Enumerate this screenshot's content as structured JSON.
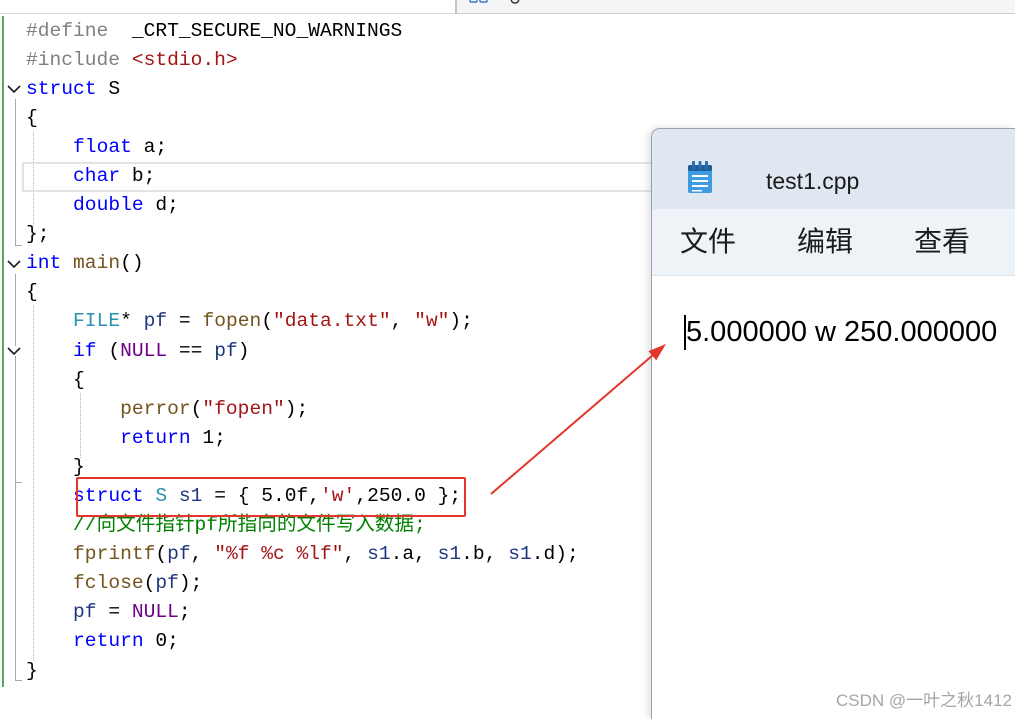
{
  "top_strip": {
    "tab_icon": "file-tab-icon"
  },
  "editor": {
    "syntax_colors": {
      "pp": "#808080",
      "kw": "#0000ff",
      "type": "#2b91af",
      "str": "#a31515",
      "fn": "#74531f",
      "var": "#1f377f",
      "macro": "#6f008a",
      "cmt": "#008000",
      "plain": "#000000"
    },
    "change_bar_color": "#58a85a",
    "fold_icon": "chevron-down-icon",
    "lines": [
      [
        {
          "kind": "pp",
          "text": "#define"
        },
        {
          "kind": "plain",
          "text": "  _CRT_SECURE_NO_WARNINGS"
        }
      ],
      [
        {
          "kind": "pp",
          "text": "#include"
        },
        {
          "kind": "plain",
          "text": " "
        },
        {
          "kind": "str",
          "text": "<stdio.h>"
        }
      ],
      [
        {
          "kind": "kw",
          "text": "struct"
        },
        {
          "kind": "plain",
          "text": " S"
        }
      ],
      [
        {
          "kind": "plain",
          "text": "{"
        }
      ],
      [
        {
          "kind": "plain",
          "text": "    "
        },
        {
          "kind": "kw",
          "text": "float"
        },
        {
          "kind": "plain",
          "text": " a;"
        }
      ],
      [
        {
          "kind": "plain",
          "text": "    "
        },
        {
          "kind": "kw",
          "text": "char"
        },
        {
          "kind": "plain",
          "text": " b;"
        }
      ],
      [
        {
          "kind": "plain",
          "text": "    "
        },
        {
          "kind": "kw",
          "text": "double"
        },
        {
          "kind": "plain",
          "text": " d;"
        }
      ],
      [
        {
          "kind": "plain",
          "text": "};"
        }
      ],
      [
        {
          "kind": "kw",
          "text": "int"
        },
        {
          "kind": "plain",
          "text": " "
        },
        {
          "kind": "fn",
          "text": "main"
        },
        {
          "kind": "plain",
          "text": "()"
        }
      ],
      [
        {
          "kind": "plain",
          "text": "{"
        }
      ],
      [
        {
          "kind": "plain",
          "text": "    "
        },
        {
          "kind": "type",
          "text": "FILE"
        },
        {
          "kind": "plain",
          "text": "* "
        },
        {
          "kind": "var",
          "text": "pf"
        },
        {
          "kind": "plain",
          "text": " = "
        },
        {
          "kind": "fn",
          "text": "fopen"
        },
        {
          "kind": "plain",
          "text": "("
        },
        {
          "kind": "str",
          "text": "\"data.txt\""
        },
        {
          "kind": "plain",
          "text": ", "
        },
        {
          "kind": "str",
          "text": "\"w\""
        },
        {
          "kind": "plain",
          "text": ");"
        }
      ],
      [
        {
          "kind": "plain",
          "text": "    "
        },
        {
          "kind": "kw",
          "text": "if"
        },
        {
          "kind": "plain",
          "text": " ("
        },
        {
          "kind": "macro",
          "text": "NULL"
        },
        {
          "kind": "plain",
          "text": " == "
        },
        {
          "kind": "var",
          "text": "pf"
        },
        {
          "kind": "plain",
          "text": ")"
        }
      ],
      [
        {
          "kind": "plain",
          "text": "    {"
        }
      ],
      [
        {
          "kind": "plain",
          "text": "        "
        },
        {
          "kind": "fn",
          "text": "perror"
        },
        {
          "kind": "plain",
          "text": "("
        },
        {
          "kind": "str",
          "text": "\"fopen\""
        },
        {
          "kind": "plain",
          "text": ");"
        }
      ],
      [
        {
          "kind": "plain",
          "text": "        "
        },
        {
          "kind": "kw",
          "text": "return"
        },
        {
          "kind": "plain",
          "text": " 1;"
        }
      ],
      [
        {
          "kind": "plain",
          "text": "    }"
        }
      ],
      [
        {
          "kind": "plain",
          "text": "    "
        },
        {
          "kind": "kw",
          "text": "struct"
        },
        {
          "kind": "plain",
          "text": " "
        },
        {
          "kind": "type",
          "text": "S"
        },
        {
          "kind": "plain",
          "text": " "
        },
        {
          "kind": "var",
          "text": "s1"
        },
        {
          "kind": "plain",
          "text": " = { 5.0f,"
        },
        {
          "kind": "str",
          "text": "'w'"
        },
        {
          "kind": "plain",
          "text": ",250.0 };"
        }
      ],
      [
        {
          "kind": "plain",
          "text": "    "
        },
        {
          "kind": "cmt",
          "text": "//向文件指针pf所指向的文件写入数据;"
        }
      ],
      [
        {
          "kind": "plain",
          "text": "    "
        },
        {
          "kind": "fn",
          "text": "fprintf"
        },
        {
          "kind": "plain",
          "text": "("
        },
        {
          "kind": "var",
          "text": "pf"
        },
        {
          "kind": "plain",
          "text": ", "
        },
        {
          "kind": "str",
          "text": "\"%f %c %lf\""
        },
        {
          "kind": "plain",
          "text": ", "
        },
        {
          "kind": "var",
          "text": "s1"
        },
        {
          "kind": "plain",
          "text": ".a, "
        },
        {
          "kind": "var",
          "text": "s1"
        },
        {
          "kind": "plain",
          "text": ".b, "
        },
        {
          "kind": "var",
          "text": "s1"
        },
        {
          "kind": "plain",
          "text": ".d);"
        }
      ],
      [
        {
          "kind": "plain",
          "text": "    "
        },
        {
          "kind": "fn",
          "text": "fclose"
        },
        {
          "kind": "plain",
          "text": "("
        },
        {
          "kind": "var",
          "text": "pf"
        },
        {
          "kind": "plain",
          "text": ");"
        }
      ],
      [
        {
          "kind": "plain",
          "text": "    "
        },
        {
          "kind": "var",
          "text": "pf"
        },
        {
          "kind": "plain",
          "text": " = "
        },
        {
          "kind": "macro",
          "text": "NULL"
        },
        {
          "kind": "plain",
          "text": ";"
        }
      ],
      [
        {
          "kind": "plain",
          "text": "    "
        },
        {
          "kind": "kw",
          "text": "return"
        },
        {
          "kind": "plain",
          "text": " 0;"
        }
      ],
      [
        {
          "kind": "plain",
          "text": "}"
        }
      ]
    ]
  },
  "annotation": {
    "color": "#e3352b"
  },
  "notepad": {
    "app_icon": "notepad-icon",
    "title": "test1.cpp",
    "title_bar_color": "#dfe7f0",
    "menu": [
      "文件",
      "编辑",
      "查看"
    ],
    "content": "5.000000 w 250.000000"
  },
  "watermark": "CSDN @一叶之秋1412"
}
